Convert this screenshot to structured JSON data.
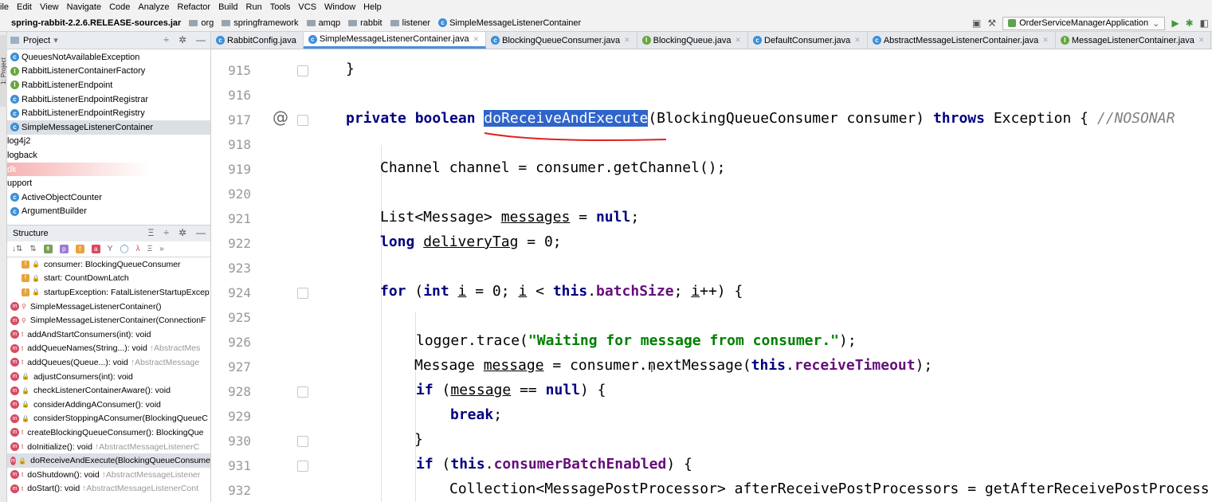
{
  "menu": [
    "ile",
    "Edit",
    "View",
    "Navigate",
    "Code",
    "Analyze",
    "Refactor",
    "Build",
    "Run",
    "Tools",
    "VCS",
    "Window",
    "Help"
  ],
  "nav": {
    "jar": "spring-rabbit-2.2.6.RELEASE-sources.jar",
    "crumbs": [
      "org",
      "springframework",
      "amqp",
      "rabbit",
      "listener"
    ],
    "current_class": "SimpleMessageListenerContainer",
    "run_config": "OrderServiceManagerApplication"
  },
  "project_panel": {
    "title": "Project",
    "items": [
      {
        "icon": "C",
        "label": "QueuesNotAvailableException"
      },
      {
        "icon": "I",
        "label": "RabbitListenerContainerFactory"
      },
      {
        "icon": "I",
        "label": "RabbitListenerEndpoint"
      },
      {
        "icon": "C",
        "label": "RabbitListenerEndpointRegistrar"
      },
      {
        "icon": "C",
        "label": "RabbitListenerEndpointRegistry"
      },
      {
        "icon": "C",
        "label": "SimpleMessageListenerContainer"
      },
      {
        "icon": "",
        "label": "log4j2"
      },
      {
        "icon": "",
        "label": "logback"
      },
      {
        "icon": "",
        "label": "dk"
      },
      {
        "icon": "",
        "label": "upport"
      },
      {
        "icon": "C",
        "label": "ActiveObjectCounter"
      },
      {
        "icon": "C",
        "label": "ArgumentBuilder"
      }
    ]
  },
  "structure_panel": {
    "title": "Structure",
    "items": [
      {
        "kind": "f",
        "label": "consumer: BlockingQueueConsumer",
        "extra": ""
      },
      {
        "kind": "f",
        "label": "start: CountDownLatch",
        "extra": ""
      },
      {
        "kind": "f",
        "label": "startupException: FatalListenerStartupExcep",
        "extra": ""
      },
      {
        "kind": "m",
        "label": "SimpleMessageListenerContainer()",
        "extra": ""
      },
      {
        "kind": "m",
        "label": "SimpleMessageListenerContainer(ConnectionF",
        "extra": ""
      },
      {
        "kind": "m",
        "label": "addAndStartConsumers(int): void",
        "extra": ""
      },
      {
        "kind": "m",
        "label": "addQueueNames(String...): void",
        "extra": "↑AbstractMes"
      },
      {
        "kind": "m",
        "label": "addQueues(Queue...): void",
        "extra": "↑AbstractMessage"
      },
      {
        "kind": "m",
        "label": "adjustConsumers(int): void",
        "extra": ""
      },
      {
        "kind": "m",
        "label": "checkListenerContainerAware(): void",
        "extra": ""
      },
      {
        "kind": "m",
        "label": "considerAddingAConsumer(): void",
        "extra": ""
      },
      {
        "kind": "m",
        "label": "considerStoppingAConsumer(BlockingQueueC",
        "extra": ""
      },
      {
        "kind": "m",
        "label": "createBlockingQueueConsumer(): BlockingQue",
        "extra": ""
      },
      {
        "kind": "m",
        "label": "doInitialize(): void",
        "extra": "↑AbstractMessageListenerC"
      },
      {
        "kind": "m",
        "label": "doReceiveAndExecute(BlockingQueueConsume",
        "extra": ""
      },
      {
        "kind": "m",
        "label": "doShutdown(): void",
        "extra": "↑AbstractMessageListener"
      },
      {
        "kind": "m",
        "label": "doStart(): void",
        "extra": "↑AbstractMessageListenerCont"
      }
    ]
  },
  "tabs": [
    {
      "icon": "C",
      "label": "RabbitConfig.java"
    },
    {
      "icon": "C",
      "label": "SimpleMessageListenerContainer.java"
    },
    {
      "icon": "C",
      "label": "BlockingQueueConsumer.java"
    },
    {
      "icon": "I",
      "label": "BlockingQueue.java"
    },
    {
      "icon": "C",
      "label": "DefaultConsumer.java"
    },
    {
      "icon": "C",
      "label": "AbstractMessageListenerContainer.java"
    },
    {
      "icon": "I",
      "label": "MessageListenerContainer.java"
    }
  ],
  "line_numbers": [
    "915",
    "916",
    "917",
    "918",
    "919",
    "920",
    "921",
    "922",
    "923",
    "924",
    "925",
    "926",
    "927",
    "928",
    "929",
    "930",
    "931",
    "932"
  ],
  "code": {
    "l915": "}",
    "l917_a": "private boolean",
    "l917_method": "doReceiveAndExecute",
    "l917_b": "(BlockingQueueConsumer consumer)",
    "l917_throws": "throws",
    "l917_c": "Exception {",
    "l917_comment": "//NOSONAR",
    "l919": "Channel channel = consumer.getChannel();",
    "l921_a": "List<Message>",
    "l921_var": "messages",
    "l921_b": "=",
    "l921_null": "null",
    "l921_c": ";",
    "l922_kw": "long",
    "l922_var": "deliveryTag",
    "l922_b": "= 0;",
    "l924_for": "for",
    "l924_a": "(",
    "l924_int": "int",
    "l924_i1": "i",
    "l924_b": "= 0;",
    "l924_i2": "i",
    "l924_c": "<",
    "l924_this": "this",
    "l924_d": ".",
    "l924_field": "batchSize",
    "l924_e": ";",
    "l924_i3": "i",
    "l924_f": "++) {",
    "l926_a": "logger.trace(",
    "l926_str": "\"Waiting for message from consumer.\"",
    "l926_b": ");",
    "l927_a": "Message",
    "l927_var": "message",
    "l927_b": "= consumer.nextMessage(",
    "l927_this": "this",
    "l927_c": ".",
    "l927_field": "receiveTimeout",
    "l927_d": ");",
    "l928_if": "if",
    "l928_a": "(",
    "l928_var": "message",
    "l928_b": "==",
    "l928_null": "null",
    "l928_c": ") {",
    "l929_break": "break",
    "l929_a": ";",
    "l930": "}",
    "l931_if": "if",
    "l931_a": "(",
    "l931_this": "this",
    "l931_b": ".",
    "l931_field": "consumerBatchEnabled",
    "l931_c": ") {",
    "l932": "Collection<MessagePostProcessor> afterReceivePostProcessors = getAfterReceivePostProcess"
  }
}
